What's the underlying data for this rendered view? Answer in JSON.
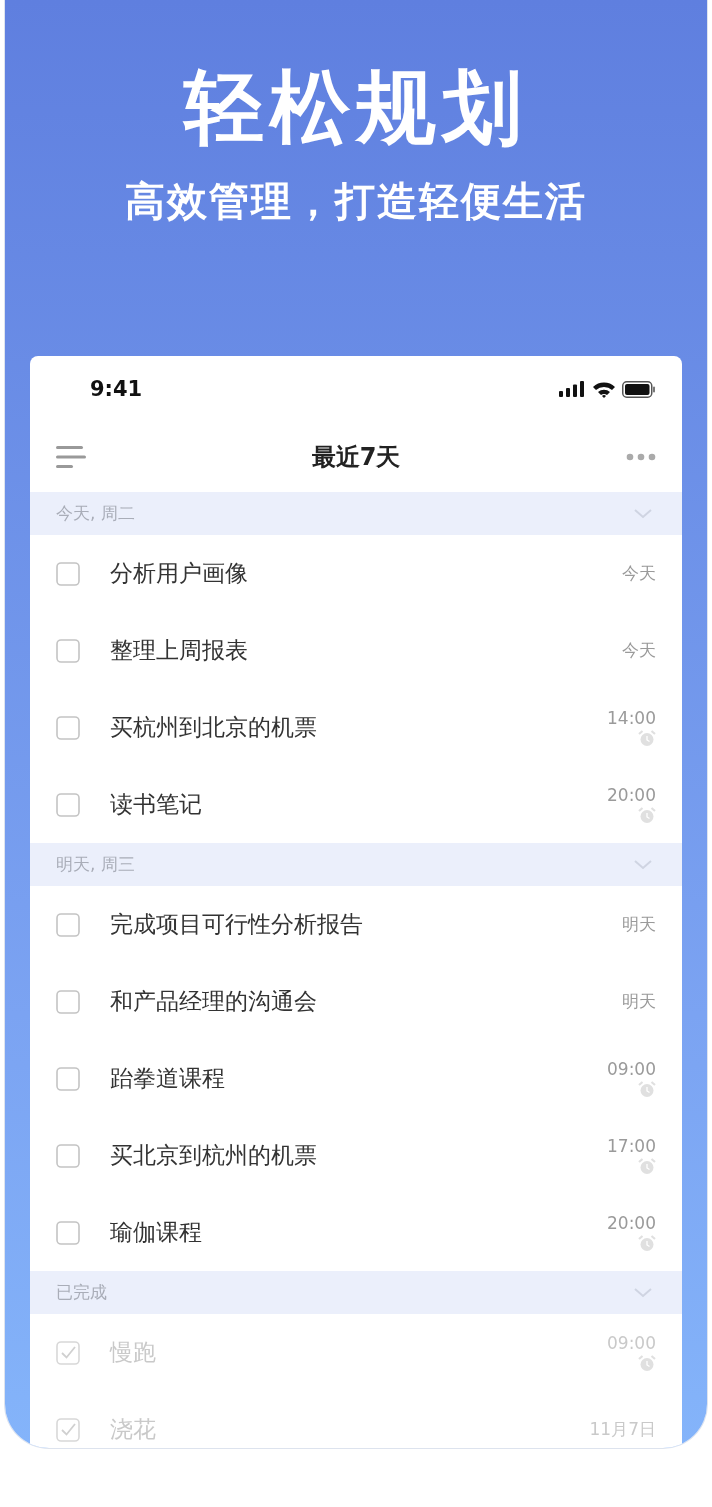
{
  "banner": {
    "headline": "轻松规划",
    "subtitle": "高效管理，打造轻便生活"
  },
  "status_bar": {
    "time": "9:41"
  },
  "nav": {
    "title": "最近7天"
  },
  "sections": [
    {
      "label": "今天, 周二",
      "expanded": true,
      "tasks": [
        {
          "title": "分析用户画像",
          "due": "今天",
          "alarm": false,
          "checked": false
        },
        {
          "title": "整理上周报表",
          "due": "今天",
          "alarm": false,
          "checked": false
        },
        {
          "title": "买杭州到北京的机票",
          "due": "14:00",
          "alarm": true,
          "checked": false
        },
        {
          "title": "读书笔记",
          "due": "20:00",
          "alarm": true,
          "checked": false
        }
      ]
    },
    {
      "label": "明天, 周三",
      "expanded": true,
      "tasks": [
        {
          "title": "完成项目可行性分析报告",
          "due": "明天",
          "alarm": false,
          "checked": false
        },
        {
          "title": "和产品经理的沟通会",
          "due": "明天",
          "alarm": false,
          "checked": false
        },
        {
          "title": "跆拳道课程",
          "due": "09:00",
          "alarm": true,
          "checked": false
        },
        {
          "title": "买北京到杭州的机票",
          "due": "17:00",
          "alarm": true,
          "checked": false
        },
        {
          "title": "瑜伽课程",
          "due": "20:00",
          "alarm": true,
          "checked": false
        }
      ]
    },
    {
      "label": "已完成",
      "expanded": true,
      "tasks": [
        {
          "title": "慢跑",
          "due": "09:00",
          "alarm": true,
          "checked": true
        },
        {
          "title": "浇花",
          "due": "11月7日",
          "alarm": false,
          "checked": true
        }
      ]
    }
  ]
}
